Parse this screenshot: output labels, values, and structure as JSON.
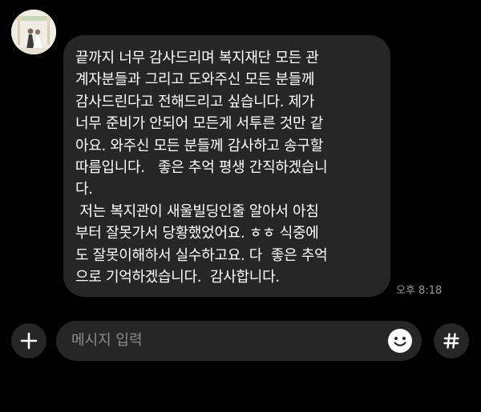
{
  "message": {
    "lines": [
      "끝까지 너무 감사드리며 복지재단 모든 관",
      "계자분들과 그리고 도와주신 모든 분들께",
      "감사드린다고 전해드리고 싶습니다. 제가",
      "너무 준비가 안되어 모든게 서투른 것만 같",
      "아요. 와주신 모든 분들께 감사하고 송구할",
      "따름입니다.   좋은 추억 평생 간직하겠습니",
      "다.",
      " 저는 복지관이 새울빌딩인줄 알아서 아침",
      "부터 잘못가서 당황했었어요. ㅎㅎ 식중에",
      "도 잘못이해하서 실수하고요. 다  좋은 추억",
      "으로 기억하겠습니다.  감사합니다."
    ],
    "time": "오후 8:18"
  },
  "composer": {
    "placeholder": "메시지 입력"
  },
  "icons": {
    "avatar": "profile-photo-wedding",
    "add": "plus-icon",
    "emoji": "smiley-icon",
    "hashtag": "hash-icon"
  },
  "colors": {
    "background": "#000000",
    "bubble": "#262626",
    "text": "#ffffff",
    "muted": "#9a9a9a"
  }
}
